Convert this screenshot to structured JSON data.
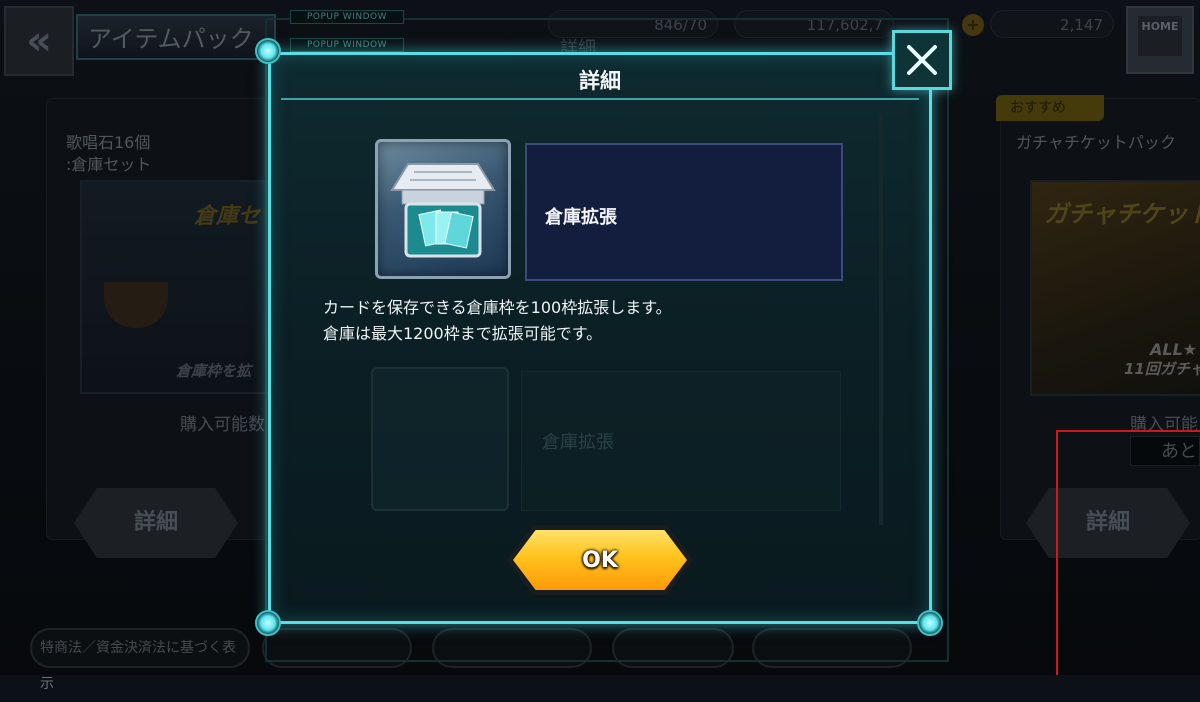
{
  "header": {
    "back_icon": "double-chevron-left-icon",
    "title": "アイテムパック",
    "stats": [
      "846/70",
      "117,602,7",
      "2,147"
    ],
    "plus_icon": "plus-icon",
    "home_label": "HOME"
  },
  "panels": {
    "left": {
      "title_line1": "歌唱石16個",
      "title_line2": ":倉庫セット",
      "banner_text": "倉庫セ",
      "caption": "倉庫枠を拡",
      "buy_text": "購入可能数",
      "detail_label": "詳細"
    },
    "right": {
      "badge": "おすすめ",
      "title": "ガチャチケットパック",
      "banner_text": "ガチャチケット",
      "banner_sub1": "ALL★",
      "banner_sub2": "11回ガチャ",
      "buy_text": "購入可能",
      "remaining_label": "あと",
      "detail_label": "詳細"
    }
  },
  "footer": {
    "legal_link": "特商法／資金決済法に基づく表示"
  },
  "background_popups": {
    "tag1": "POPUP WINDOW",
    "tag2": "POPUP WINDOW",
    "ghost_title": "詳細"
  },
  "popup": {
    "title": "詳細",
    "close_icon": "close-icon",
    "item_icon": "storage-expansion-icon",
    "item_name": "倉庫拡張",
    "description_line1": "カードを保存できる倉庫枠を100枠拡張します。",
    "description_line2": "倉庫は最大1200枠まで拡張可能です。",
    "faded_item_name": "倉庫拡張",
    "ok_label": "OK"
  },
  "colors": {
    "popup_border": "#56e0e6",
    "ok_button": "#ffc21c",
    "annotation_red": "#d01818"
  }
}
